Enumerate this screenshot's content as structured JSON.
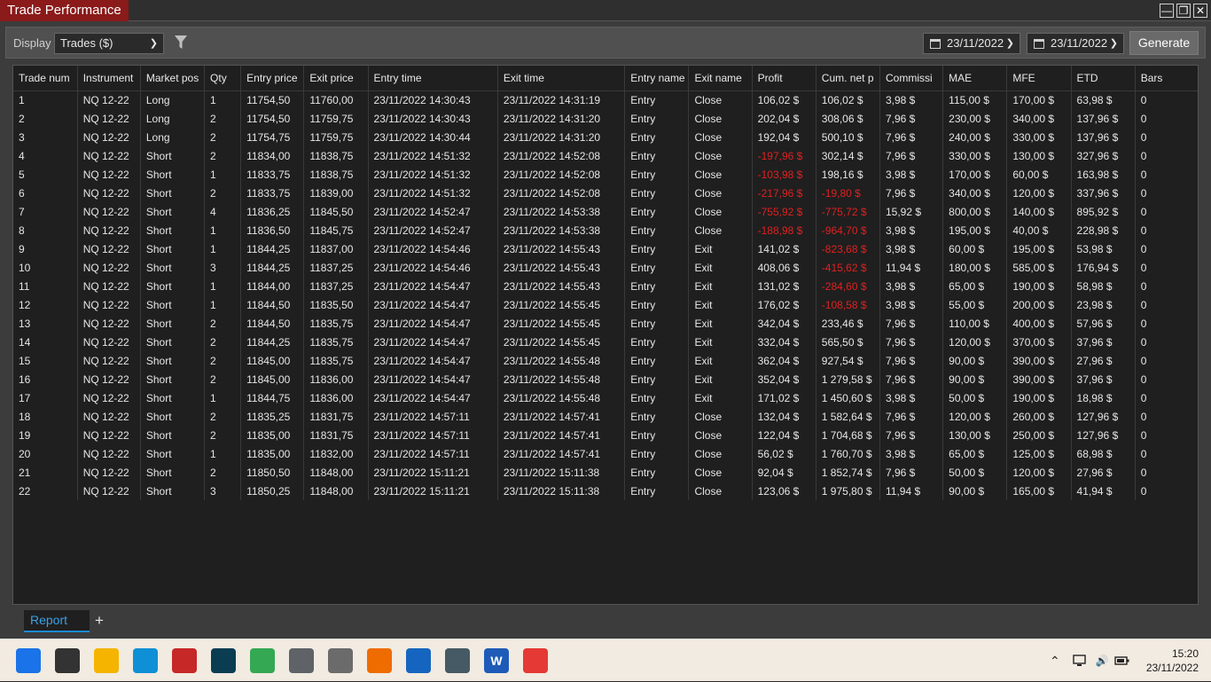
{
  "window": {
    "title": "Trade Performance",
    "minimize_glyph": "—",
    "restore_glyph": "❐",
    "close_glyph": "✕"
  },
  "toolbar": {
    "display_label": "Display",
    "display_value": "Trades ($)",
    "date_from": "23/11/2022",
    "date_to": "23/11/2022",
    "generate_label": "Generate",
    "filter_icon": "filter-icon",
    "calendar_icon": "calendar-icon"
  },
  "table": {
    "columns": [
      "Trade num",
      "Instrument",
      "Market pos",
      "Qty",
      "Entry price",
      "Exit price",
      "Entry time",
      "Exit time",
      "Entry name",
      "Exit name",
      "Profit",
      "Cum. net p",
      "Commissi",
      "MAE",
      "MFE",
      "ETD",
      "Bars"
    ],
    "rows": [
      [
        "1",
        "NQ 12-22",
        "Long",
        "1",
        "11754,50",
        "11760,00",
        "23/11/2022 14:30:43",
        "23/11/2022 14:31:19",
        "Entry",
        "Close",
        "106,02 $",
        "106,02 $",
        "3,98 $",
        "115,00 $",
        "170,00 $",
        "63,98 $",
        "0"
      ],
      [
        "2",
        "NQ 12-22",
        "Long",
        "2",
        "11754,50",
        "11759,75",
        "23/11/2022 14:30:43",
        "23/11/2022 14:31:20",
        "Entry",
        "Close",
        "202,04 $",
        "308,06 $",
        "7,96 $",
        "230,00 $",
        "340,00 $",
        "137,96 $",
        "0"
      ],
      [
        "3",
        "NQ 12-22",
        "Long",
        "2",
        "11754,75",
        "11759,75",
        "23/11/2022 14:30:44",
        "23/11/2022 14:31:20",
        "Entry",
        "Close",
        "192,04 $",
        "500,10 $",
        "7,96 $",
        "240,00 $",
        "330,00 $",
        "137,96 $",
        "0"
      ],
      [
        "4",
        "NQ 12-22",
        "Short",
        "2",
        "11834,00",
        "11838,75",
        "23/11/2022 14:51:32",
        "23/11/2022 14:52:08",
        "Entry",
        "Close",
        "-197,96 $",
        "302,14 $",
        "7,96 $",
        "330,00 $",
        "130,00 $",
        "327,96 $",
        "0"
      ],
      [
        "5",
        "NQ 12-22",
        "Short",
        "1",
        "11833,75",
        "11838,75",
        "23/11/2022 14:51:32",
        "23/11/2022 14:52:08",
        "Entry",
        "Close",
        "-103,98 $",
        "198,16 $",
        "3,98 $",
        "170,00 $",
        "60,00 $",
        "163,98 $",
        "0"
      ],
      [
        "6",
        "NQ 12-22",
        "Short",
        "2",
        "11833,75",
        "11839,00",
        "23/11/2022 14:51:32",
        "23/11/2022 14:52:08",
        "Entry",
        "Close",
        "-217,96 $",
        "-19,80 $",
        "7,96 $",
        "340,00 $",
        "120,00 $",
        "337,96 $",
        "0"
      ],
      [
        "7",
        "NQ 12-22",
        "Short",
        "4",
        "11836,25",
        "11845,50",
        "23/11/2022 14:52:47",
        "23/11/2022 14:53:38",
        "Entry",
        "Close",
        "-755,92 $",
        "-775,72 $",
        "15,92 $",
        "800,00 $",
        "140,00 $",
        "895,92 $",
        "0"
      ],
      [
        "8",
        "NQ 12-22",
        "Short",
        "1",
        "11836,50",
        "11845,75",
        "23/11/2022 14:52:47",
        "23/11/2022 14:53:38",
        "Entry",
        "Close",
        "-188,98 $",
        "-964,70 $",
        "3,98 $",
        "195,00 $",
        "40,00 $",
        "228,98 $",
        "0"
      ],
      [
        "9",
        "NQ 12-22",
        "Short",
        "1",
        "11844,25",
        "11837,00",
        "23/11/2022 14:54:46",
        "23/11/2022 14:55:43",
        "Entry",
        "Exit",
        "141,02 $",
        "-823,68 $",
        "3,98 $",
        "60,00 $",
        "195,00 $",
        "53,98 $",
        "0"
      ],
      [
        "10",
        "NQ 12-22",
        "Short",
        "3",
        "11844,25",
        "11837,25",
        "23/11/2022 14:54:46",
        "23/11/2022 14:55:43",
        "Entry",
        "Exit",
        "408,06 $",
        "-415,62 $",
        "11,94 $",
        "180,00 $",
        "585,00 $",
        "176,94 $",
        "0"
      ],
      [
        "11",
        "NQ 12-22",
        "Short",
        "1",
        "11844,00",
        "11837,25",
        "23/11/2022 14:54:47",
        "23/11/2022 14:55:43",
        "Entry",
        "Exit",
        "131,02 $",
        "-284,60 $",
        "3,98 $",
        "65,00 $",
        "190,00 $",
        "58,98 $",
        "0"
      ],
      [
        "12",
        "NQ 12-22",
        "Short",
        "1",
        "11844,50",
        "11835,50",
        "23/11/2022 14:54:47",
        "23/11/2022 14:55:45",
        "Entry",
        "Exit",
        "176,02 $",
        "-108,58 $",
        "3,98 $",
        "55,00 $",
        "200,00 $",
        "23,98 $",
        "0"
      ],
      [
        "13",
        "NQ 12-22",
        "Short",
        "2",
        "11844,50",
        "11835,75",
        "23/11/2022 14:54:47",
        "23/11/2022 14:55:45",
        "Entry",
        "Exit",
        "342,04 $",
        "233,46 $",
        "7,96 $",
        "110,00 $",
        "400,00 $",
        "57,96 $",
        "0"
      ],
      [
        "14",
        "NQ 12-22",
        "Short",
        "2",
        "11844,25",
        "11835,75",
        "23/11/2022 14:54:47",
        "23/11/2022 14:55:45",
        "Entry",
        "Exit",
        "332,04 $",
        "565,50 $",
        "7,96 $",
        "120,00 $",
        "370,00 $",
        "37,96 $",
        "0"
      ],
      [
        "15",
        "NQ 12-22",
        "Short",
        "2",
        "11845,00",
        "11835,75",
        "23/11/2022 14:54:47",
        "23/11/2022 14:55:48",
        "Entry",
        "Exit",
        "362,04 $",
        "927,54 $",
        "7,96 $",
        "90,00 $",
        "390,00 $",
        "27,96 $",
        "0"
      ],
      [
        "16",
        "NQ 12-22",
        "Short",
        "2",
        "11845,00",
        "11836,00",
        "23/11/2022 14:54:47",
        "23/11/2022 14:55:48",
        "Entry",
        "Exit",
        "352,04 $",
        "1 279,58 $",
        "7,96 $",
        "90,00 $",
        "390,00 $",
        "37,96 $",
        "0"
      ],
      [
        "17",
        "NQ 12-22",
        "Short",
        "1",
        "11844,75",
        "11836,00",
        "23/11/2022 14:54:47",
        "23/11/2022 14:55:48",
        "Entry",
        "Exit",
        "171,02 $",
        "1 450,60 $",
        "3,98 $",
        "50,00 $",
        "190,00 $",
        "18,98 $",
        "0"
      ],
      [
        "18",
        "NQ 12-22",
        "Short",
        "2",
        "11835,25",
        "11831,75",
        "23/11/2022 14:57:11",
        "23/11/2022 14:57:41",
        "Entry",
        "Close",
        "132,04 $",
        "1 582,64 $",
        "7,96 $",
        "120,00 $",
        "260,00 $",
        "127,96 $",
        "0"
      ],
      [
        "19",
        "NQ 12-22",
        "Short",
        "2",
        "11835,00",
        "11831,75",
        "23/11/2022 14:57:11",
        "23/11/2022 14:57:41",
        "Entry",
        "Close",
        "122,04 $",
        "1 704,68 $",
        "7,96 $",
        "130,00 $",
        "250,00 $",
        "127,96 $",
        "0"
      ],
      [
        "20",
        "NQ 12-22",
        "Short",
        "1",
        "11835,00",
        "11832,00",
        "23/11/2022 14:57:11",
        "23/11/2022 14:57:41",
        "Entry",
        "Close",
        "56,02 $",
        "1 760,70 $",
        "3,98 $",
        "65,00 $",
        "125,00 $",
        "68,98 $",
        "0"
      ],
      [
        "21",
        "NQ 12-22",
        "Short",
        "2",
        "11850,50",
        "11848,00",
        "23/11/2022 15:11:21",
        "23/11/2022 15:11:38",
        "Entry",
        "Close",
        "92,04 $",
        "1 852,74 $",
        "7,96 $",
        "50,00 $",
        "120,00 $",
        "27,96 $",
        "0"
      ],
      [
        "22",
        "NQ 12-22",
        "Short",
        "3",
        "11850,25",
        "11848,00",
        "23/11/2022 15:11:21",
        "23/11/2022 15:11:38",
        "Entry",
        "Close",
        "123,06 $",
        "1 975,80 $",
        "11,94 $",
        "90,00 $",
        "165,00 $",
        "41,94 $",
        "0"
      ]
    ]
  },
  "tabs": {
    "active_label": "Report",
    "add_label": "+"
  },
  "taskbar": {
    "apps": [
      {
        "name": "start-icon",
        "glyph": "",
        "color": "#1a73e8"
      },
      {
        "name": "task-view-icon",
        "glyph": "",
        "color": "#333333"
      },
      {
        "name": "file-explorer-icon",
        "glyph": "",
        "color": "#f4b400"
      },
      {
        "name": "edge-icon",
        "glyph": "",
        "color": "#0f8fd6"
      },
      {
        "name": "app-red-icon",
        "glyph": "",
        "color": "#c62828"
      },
      {
        "name": "app-teal-icon",
        "glyph": "",
        "color": "#0b3d52"
      },
      {
        "name": "chrome-icon",
        "glyph": "",
        "color": "#34a853"
      },
      {
        "name": "calculator-icon",
        "glyph": "",
        "color": "#5f6368"
      },
      {
        "name": "feedback-icon",
        "glyph": "",
        "color": "#6b6b6b"
      },
      {
        "name": "vlc-icon",
        "glyph": "",
        "color": "#ef6c00"
      },
      {
        "name": "calendar-app-icon",
        "glyph": "",
        "color": "#1565c0"
      },
      {
        "name": "media-app-icon",
        "glyph": "",
        "color": "#455a64"
      },
      {
        "name": "word-icon",
        "glyph": "W",
        "color": "#1e5bb8"
      },
      {
        "name": "snipping-tool-icon",
        "glyph": "",
        "color": "#e53935"
      }
    ],
    "clock_time": "15:20",
    "clock_date": "23/11/2022",
    "tray_chevron": "⌃",
    "speaker_glyph": "🔊"
  }
}
